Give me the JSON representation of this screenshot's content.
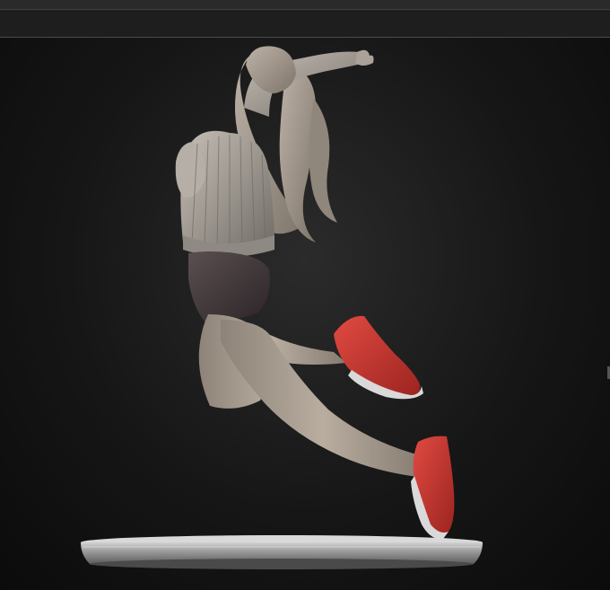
{
  "app": {
    "view": "3d-sculpt-viewport"
  },
  "colors": {
    "background": "#1e1e1e",
    "viewport_center": "#2b2b2b",
    "clay": "#9a958f",
    "shorts": "#3d3436",
    "sneakers": "#c8342f",
    "base": "#a7a7a7"
  },
  "model": {
    "icons": {
      "figure": "sculpt-figure-icon",
      "base": "display-base-icon"
    }
  }
}
